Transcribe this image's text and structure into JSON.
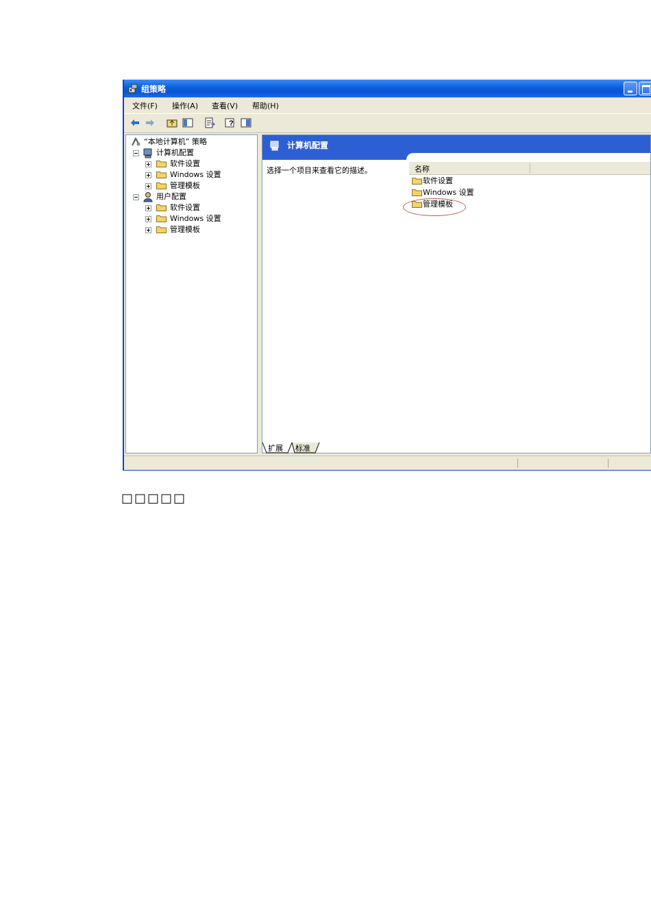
{
  "window": {
    "title": "组策略",
    "colors": {
      "titlebar": "#0b55d1",
      "pane_header": "#2d5fd4",
      "highlight": "#c0504d"
    }
  },
  "menu": [
    {
      "label": "文件(F)"
    },
    {
      "label": "操作(A)"
    },
    {
      "label": "查看(V)"
    },
    {
      "label": "帮助(H)"
    }
  ],
  "toolbar": [
    "back-icon",
    "forward-icon",
    "up-folder-icon",
    "show-hide-tree-icon",
    "export-list-icon",
    "help-icon",
    "console-tree-icon"
  ],
  "tree": {
    "root": "“本地计算机” 策略",
    "computer_config": "计算机配置",
    "computer_children": [
      "软件设置",
      "Windows 设置",
      "管理模板"
    ],
    "user_config": "用户配置",
    "user_children": [
      "软件设置",
      "Windows 设置",
      "管理模板"
    ]
  },
  "right_pane": {
    "header_title": "计算机配置",
    "description": "选择一个项目来查看它的描述。",
    "column_name": "名称",
    "items": [
      "软件设置",
      "Windows 设置",
      "管理模板"
    ],
    "highlighted_item": "管理模板"
  },
  "tabs": [
    "扩展",
    "标准"
  ],
  "caption": "□□□□□"
}
